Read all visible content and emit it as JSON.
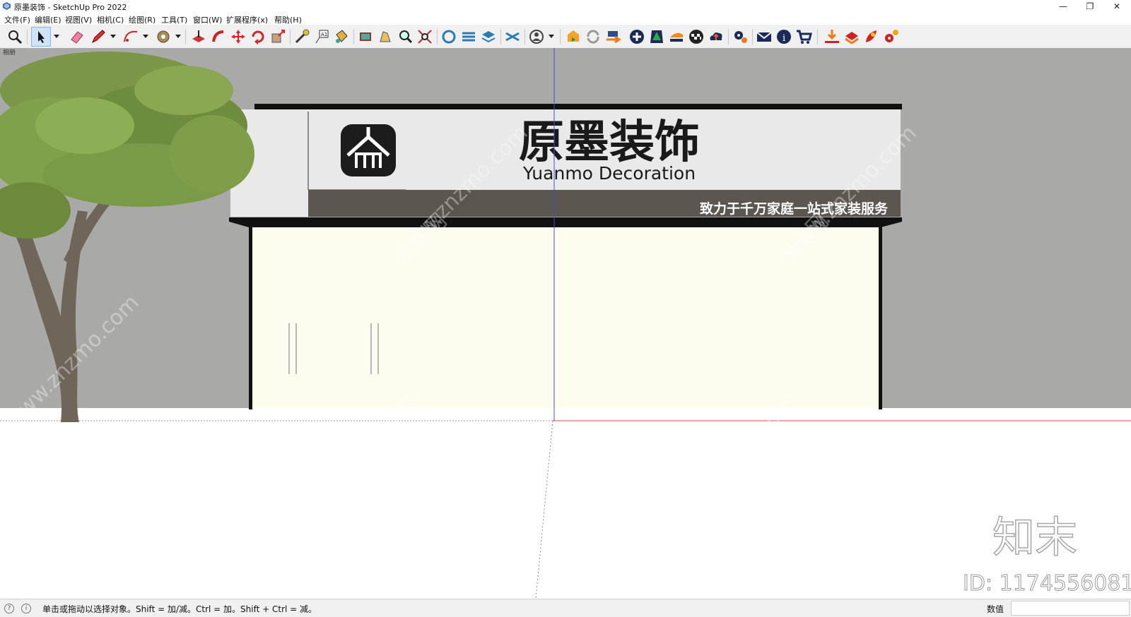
{
  "window": {
    "title": "原墨装饰 - SketchUp Pro 2022",
    "buttons": {
      "minimize": "—",
      "restore": "❐",
      "close": "✕"
    }
  },
  "menu": [
    "文件(F)",
    "编辑(E)",
    "视图(V)",
    "相机(C)",
    "绘图(R)",
    "工具(T)",
    "窗口(W)",
    "扩展程序(x)",
    "帮助(H)"
  ],
  "toolbar": {
    "icons": [
      "zoom-icon",
      "select-arrow-icon",
      "eraser-icon",
      "pencil-icon",
      "arc-icon",
      "paint-icon",
      "pushpull-icon",
      "followme-icon",
      "move-icon",
      "rotate-icon",
      "scale-icon",
      "tape-icon",
      "text-icon",
      "paint-bucket-icon",
      "section-icon",
      "orbit-icon",
      "zoom-window-icon",
      "zoom-extents-icon",
      "component-icon",
      "layers-icon",
      "styles-icon",
      "shadows-icon",
      "user-icon",
      "warehouse-icon",
      "refresh-icon",
      "export-icon",
      "add-icon",
      "tree-icon",
      "layers-stack-icon",
      "checker-icon",
      "cloud-upload-icon",
      "settings-gears-icon",
      "mail-icon",
      "info-icon",
      "cart-icon",
      "download-icon",
      "extension-icon",
      "rocket-icon",
      "cogs-icon"
    ]
  },
  "scene": {
    "sign": {
      "brand_cn": "原墨装饰",
      "brand_en": "Yuanmo Decoration",
      "slogan": "致力于千万家庭一站式家装服务"
    },
    "watermark": {
      "site": "www.znzmo.com",
      "brand_cn": "知末网",
      "logo_cn": "知末",
      "id_text": "ID: 1174556081"
    },
    "viewport_tag": "相册",
    "colors": {
      "wall": "#a9aaa8",
      "sign_panel": "#e9e9e9",
      "sign_band": "#5b5650",
      "storefront": "#fcfcef",
      "frame": "#111111",
      "axis_blue": "#4a4ad0",
      "axis_red": "#c85050"
    }
  },
  "status": {
    "message": "单击或拖动以选择对象。Shift = 加/减。Ctrl = 加。Shift + Ctrl = 减。",
    "value_label": "数值",
    "value": ""
  }
}
